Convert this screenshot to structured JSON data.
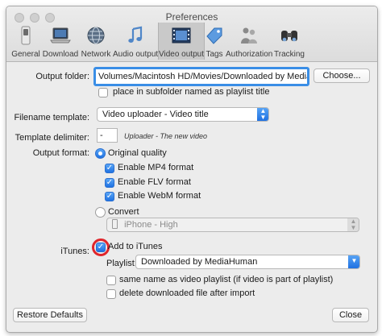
{
  "window": {
    "title": "Preferences"
  },
  "toolbar": [
    {
      "label": "General",
      "icon": "switch-icon"
    },
    {
      "label": "Download",
      "icon": "laptop-icon"
    },
    {
      "label": "Network",
      "icon": "globe-icon"
    },
    {
      "label": "Audio output",
      "icon": "music-note-icon"
    },
    {
      "label": "Video output",
      "icon": "film-strip-icon"
    },
    {
      "label": "Tags",
      "icon": "tag-icon"
    },
    {
      "label": "Authorization",
      "icon": "people-icon"
    },
    {
      "label": "Tracking",
      "icon": "binoculars-icon"
    }
  ],
  "output_folder": {
    "label": "Output folder:",
    "value": "Volumes/Macintosh HD/Movies/Downloaded by MediaHuman",
    "choose_label": "Choose...",
    "subfolder_label": "place in subfolder named as playlist title"
  },
  "filename_template": {
    "label": "Filename template:",
    "value": "Video uploader - Video title"
  },
  "template_delimiter": {
    "label": "Template delimiter:",
    "value": "-",
    "hint": "Uploader - The new video"
  },
  "output_format": {
    "label": "Output format:",
    "original_label": "Original quality",
    "enable_mp4": "Enable MP4 format",
    "enable_flv": "Enable FLV format",
    "enable_webm": "Enable WebM format",
    "convert_label": "Convert",
    "convert_profile": "iPhone - High"
  },
  "itunes": {
    "label": "iTunes:",
    "add_label": "Add to iTunes",
    "playlist_label": "Playlist:",
    "playlist_value": "Downloaded by MediaHuman",
    "same_name_label": "same name as video playlist (if video is part of playlist)",
    "delete_label": "delete downloaded file after import"
  },
  "footer": {
    "restore_label": "Restore Defaults",
    "close_label": "Close"
  },
  "colors": {
    "accent": "#1f72e2",
    "focus_ring": "#3a8ee6",
    "highlight_circle": "#e0262c"
  }
}
